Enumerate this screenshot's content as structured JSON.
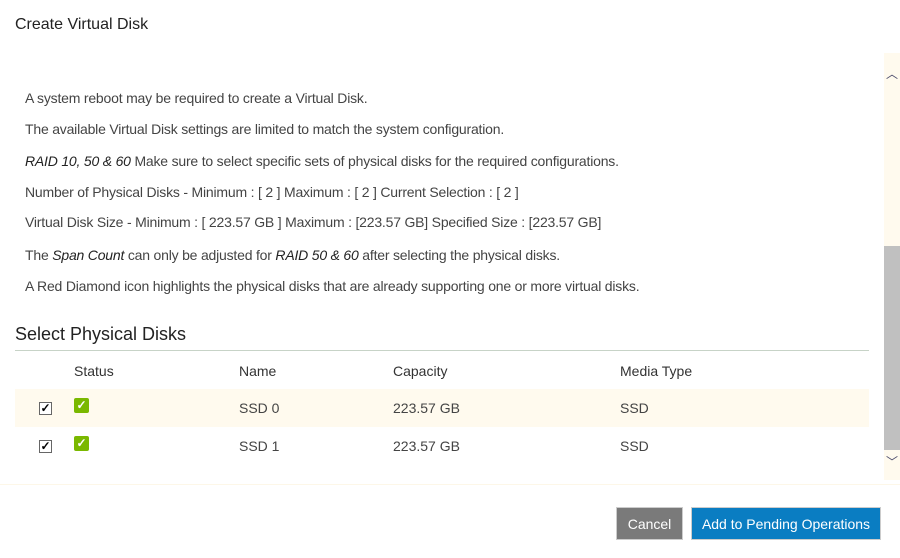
{
  "title": "Create Virtual Disk",
  "info": {
    "l1": "A system reboot may be required to create a Virtual Disk.",
    "l2": "The available Virtual Disk settings are limited to match the system configuration.",
    "l3_em": "RAID 10, 50 & 60",
    "l3": " Make sure to select specific sets of physical disks for the required configurations.",
    "l4": "Number of Physical Disks - Minimum : [ 2 ] Maximum : [ 2 ] Current Selection : [ 2 ]",
    "l5": "Virtual Disk Size - Minimum : [ 223.57 GB ] Maximum : [223.57 GB] Specified Size : [223.57 GB]",
    "l6a": "The ",
    "l6_em1": "Span Count",
    "l6b": " can only be adjusted for ",
    "l6_em2": "RAID 50 & 60",
    "l6c": "  after selecting the physical disks.",
    "l7": "A Red Diamond icon highlights the physical disks that are already supporting one or more virtual disks."
  },
  "section": "Select Physical Disks",
  "columns": [
    "Status",
    "Name",
    "Capacity",
    "Media Type"
  ],
  "rows": [
    {
      "checked": true,
      "status": "ok",
      "name": "SSD 0",
      "capacity": "223.57 GB",
      "media": "SSD"
    },
    {
      "checked": true,
      "status": "ok",
      "name": "SSD 1",
      "capacity": "223.57 GB",
      "media": "SSD"
    }
  ],
  "buttons": {
    "cancel": "Cancel",
    "add": "Add to Pending Operations"
  },
  "colors": {
    "primary": "#0a7dc2",
    "cancel": "#7a7a7a",
    "status_ok": "#7ab800",
    "row_highlight": "#fffaee"
  }
}
